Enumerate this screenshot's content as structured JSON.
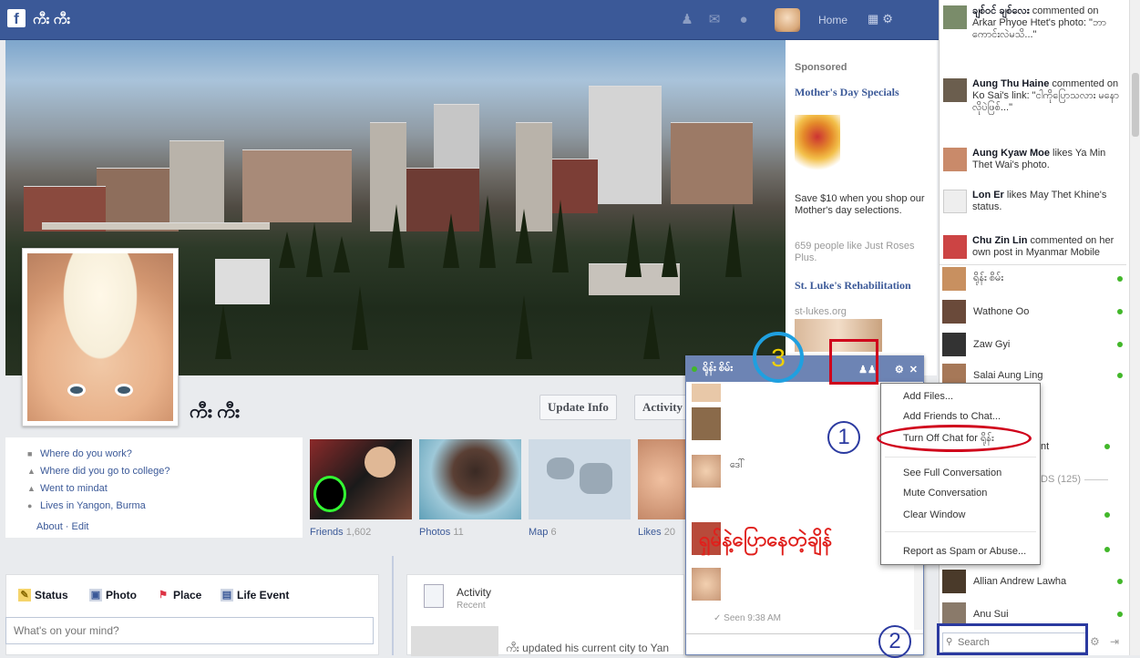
{
  "topbar": {
    "profile_name": "ကီး ကီး",
    "home": "Home",
    "logo": "f"
  },
  "profile": {
    "name": "ကီး ကီး",
    "update_info": "Update Info",
    "activity_log": "Activity"
  },
  "about": {
    "lines": [
      "Where do you work?",
      "Where did you go to college?",
      "Went to mindat",
      "Lives in Yangon, Burma"
    ],
    "about_edit": "About · Edit"
  },
  "tiles": [
    {
      "label": "Friends",
      "count": "1,602"
    },
    {
      "label": "Photos",
      "count": "11"
    },
    {
      "label": "Map",
      "count": "6"
    },
    {
      "label": "Likes",
      "count": "20"
    }
  ],
  "composer": {
    "tabs": [
      "Status",
      "Photo",
      "Place",
      "Life Event"
    ],
    "placeholder": "What's on your mind?"
  },
  "activity_box": {
    "title": "Activity",
    "subtitle": "Recent",
    "item": "ကီး updated his current city to Yan"
  },
  "sponsored": {
    "header": "Sponsored",
    "ad1_title": "Mother's Day Specials",
    "ad1_text": "Save $10 when you shop our Mother's day selections.",
    "ad1_likes": "659 people like Just Roses Plus.",
    "ad2_title": "St. Luke's Rehabilitation",
    "ad2_url": "st-lukes.org"
  },
  "ticker": [
    {
      "name": "ချစ်ဝင် ချစ်လေး",
      "text": " commented on Arkar Phyoe Htet's photo: \"ဘာကောင်းလဲမသိ...\""
    },
    {
      "name": "Aung Thu Haine",
      "text": " commented on Ko Sai's link: \"ငါကိုပြောသလား မနောလိုပဲဖြစ်...\""
    },
    {
      "name": "Aung Kyaw Moe",
      "text": " likes Ya Min Thet Wai's photo."
    },
    {
      "name": "Lon Er",
      "text": " likes May Thet Khine's status."
    },
    {
      "name": "Chu Zin Lin",
      "text": " commented on her own post in Myanmar Mobile"
    }
  ],
  "chat_list": [
    "ရိုန်း စိမ်း",
    "Wathone Oo",
    "Zaw Gyi",
    "Salai Aung Ling",
    "Allian Andrew Lawha",
    "Anu Sui"
  ],
  "chat_list_partial": {
    "more_text": "nt",
    "group": "DS (125)"
  },
  "chat_window": {
    "title": "ရိုန်း စိမ်း",
    "message_red": "ရှမ်နဲ့ပြောနေတဲ့ချိန်",
    "seen": "Seen 9:38 AM",
    "sender": "ဒေါ်"
  },
  "menu": {
    "items": [
      "Add Files...",
      "Add Friends to Chat...",
      "Turn Off Chat for ရိုန်း",
      "See Full Conversation",
      "Mute Conversation",
      "Clear Window",
      "Report as Spam or Abuse..."
    ]
  },
  "chat_search": {
    "placeholder": "Search"
  },
  "steps": [
    "1",
    "2",
    "3"
  ],
  "colors": {
    "brand": "#3b5998",
    "annotation_red": "#d0021b",
    "annotation_blue": "#2b3aa0",
    "annotation_cyan": "#1fa0e0",
    "step3_yellow": "#f0d000"
  }
}
